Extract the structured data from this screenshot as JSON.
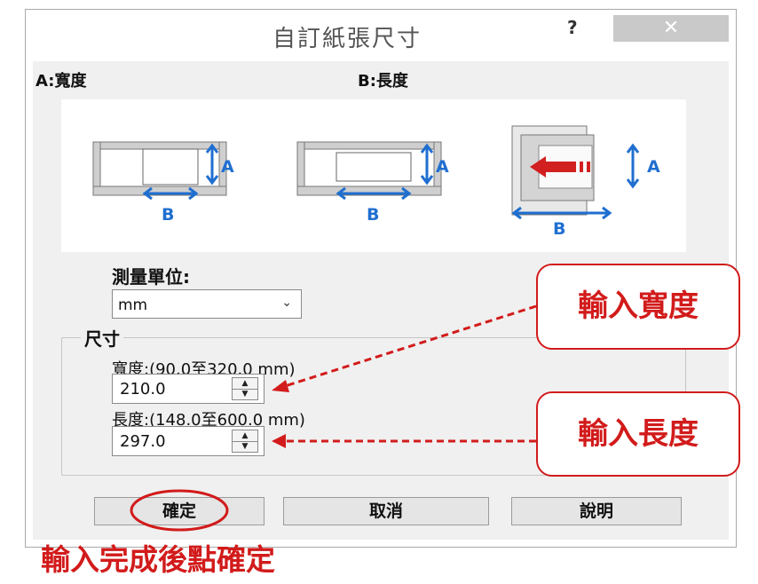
{
  "window": {
    "title": "自訂紙張尺寸",
    "help_label": "?",
    "close_label": "✕"
  },
  "diagram": {
    "width_label": "A:寬度",
    "length_label": "B:長度",
    "axis_a": "A",
    "axis_b": "B"
  },
  "unit": {
    "label": "測量單位:",
    "value": "mm"
  },
  "size": {
    "group_label": "尺寸",
    "width_label": "寬度:(90.0至320.0 mm)",
    "width_value": "210.0",
    "length_label": "長度:(148.0至600.0 mm)",
    "length_value": "297.0"
  },
  "buttons": {
    "ok": "確定",
    "cancel": "取消",
    "help": "說明"
  },
  "annotations": {
    "enter_width": "輸入寬度",
    "enter_length": "輸入長度",
    "confirm_note": "輸入完成後點確定"
  },
  "colors": {
    "annotation": "#d21b1b",
    "diagram_arrow": "#1f6fd0",
    "close_button": "#c9c9c9"
  }
}
